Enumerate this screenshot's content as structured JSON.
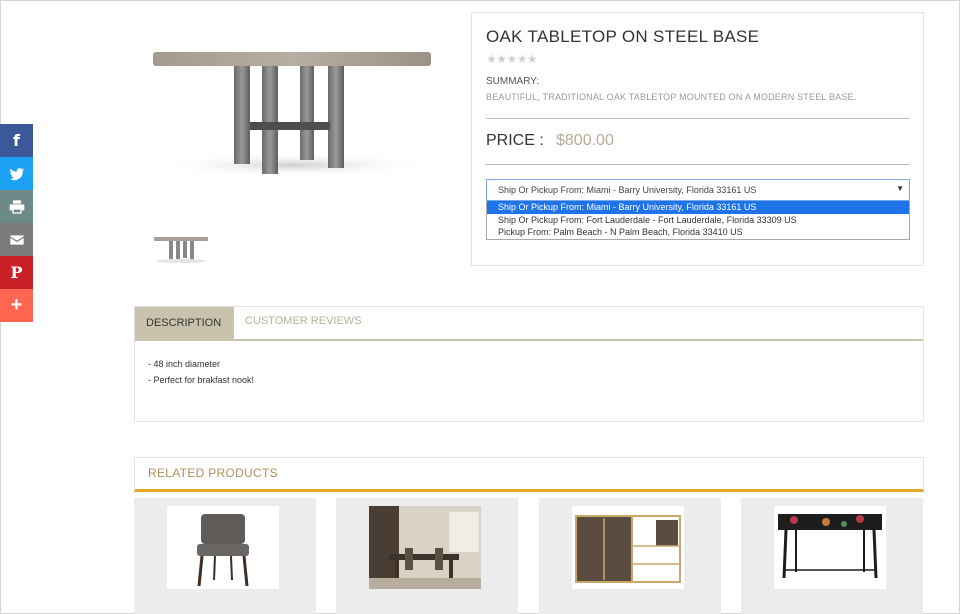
{
  "share_bar": {
    "buttons": [
      {
        "icon": "facebook-icon",
        "color": "#3b5998",
        "glyph": "f"
      },
      {
        "icon": "twitter-icon",
        "color": "#1da1f2"
      },
      {
        "icon": "print-icon",
        "color": "#6d8a89"
      },
      {
        "icon": "email-icon",
        "color": "#7b7b7b"
      },
      {
        "icon": "pinterest-icon",
        "color": "#cb2027",
        "glyph": "P"
      },
      {
        "icon": "more-icon",
        "color": "#ff6550",
        "glyph": "+"
      }
    ]
  },
  "product": {
    "title": "OAK TABLETOP ON STEEL BASE",
    "rating_stars": "★★★★★",
    "summary_label": "SUMMARY:",
    "summary_text": "BEAUTIFUL, TRADITIONAL OAK TABLETOP MOUNTED ON A MODERN STEEL BASE.",
    "price_label": "PRICE :",
    "price_value": "$800.00"
  },
  "shipping_select": {
    "selected": "Ship Or Pickup From:   Miami - Barry University, Florida 33161 US",
    "caret": "▼",
    "options": [
      "Ship Or Pickup From:   Miami - Barry University, Florida 33161 US",
      "Ship Or Pickup From:   Fort Lauderdale - Fort Lauderdale, Florida 33309 US",
      "Pickup From:   Palm Beach - N Palm Beach, Florida 33410 US"
    ]
  },
  "tabs": {
    "description": "DESCRIPTION",
    "reviews": "CUSTOMER REVIEWS",
    "description_lines": [
      "- 48 inch diameter",
      "- Perfect for brakfast nook!"
    ]
  },
  "related": {
    "title": "RELATED PRODUCTS",
    "items": [
      {
        "name": "dining-chair"
      },
      {
        "name": "dining-room-set"
      },
      {
        "name": "bar-cabinet"
      },
      {
        "name": "console-table"
      }
    ]
  },
  "colors": {
    "accent_gold": "#e5a826",
    "tab_active": "#c9c3ae",
    "price": "#b7ad96",
    "select_highlight": "#1e73e8"
  }
}
